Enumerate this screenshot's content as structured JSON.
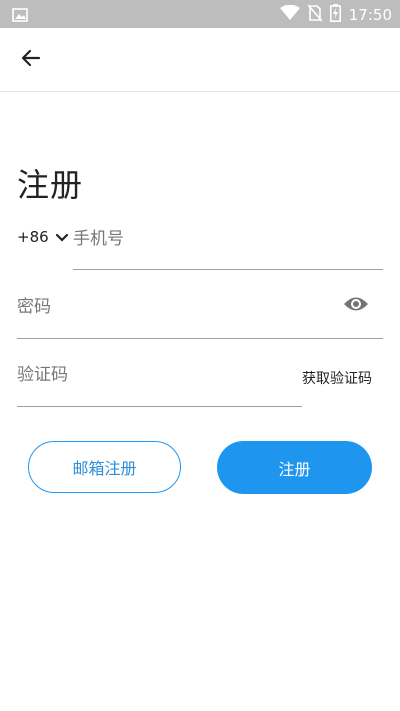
{
  "status_bar": {
    "time": "17:50",
    "icons": [
      "image-icon",
      "wifi-icon",
      "no-sim-icon",
      "battery-charging-icon"
    ]
  },
  "app_bar": {
    "back_icon": "back-arrow-icon"
  },
  "page": {
    "title": "注册"
  },
  "form": {
    "country_code": "+86",
    "phone_placeholder": "手机号",
    "password_placeholder": "密码",
    "code_placeholder": "验证码",
    "get_code_label": "获取验证码"
  },
  "buttons": {
    "email_register": "邮箱注册",
    "register": "注册"
  },
  "colors": {
    "accent": "#1e96f0",
    "status_bar": "#bdbdbd"
  }
}
